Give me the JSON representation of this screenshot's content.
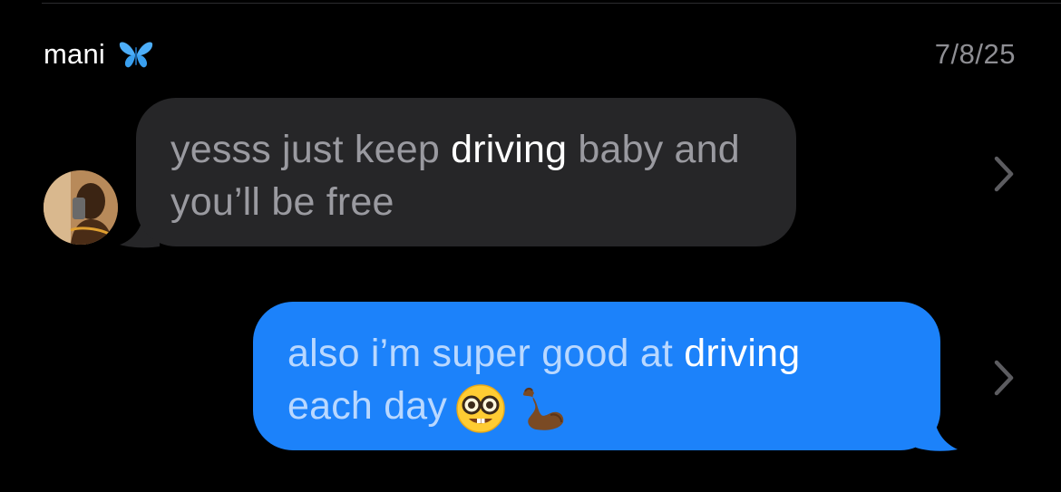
{
  "header": {
    "sender_name": "mani",
    "sender_emoji_icon": "butterfly-icon",
    "date": "7/8/25"
  },
  "messages": [
    {
      "direction": "incoming",
      "segments": [
        {
          "text": "yesss just keep ",
          "highlight": false
        },
        {
          "text": "driving",
          "highlight": true
        },
        {
          "text": " baby and you’ll be free",
          "highlight": false
        }
      ]
    },
    {
      "direction": "outgoing",
      "segments": [
        {
          "text": "also i’m super good at ",
          "highlight": false
        },
        {
          "text": "driving",
          "highlight": true
        },
        {
          "text": " each day",
          "highlight": false
        }
      ],
      "emojis": [
        "nerd-face-emoji",
        "flexed-biceps-emoji"
      ]
    }
  ],
  "colors": {
    "background": "#000000",
    "incoming_bubble": "#262628",
    "outgoing_bubble": "#1c82fa",
    "incoming_text": "#9a9aa0",
    "outgoing_text": "#b9d8ff",
    "highlight_text": "#ffffff",
    "date_text": "#8e8e93"
  }
}
